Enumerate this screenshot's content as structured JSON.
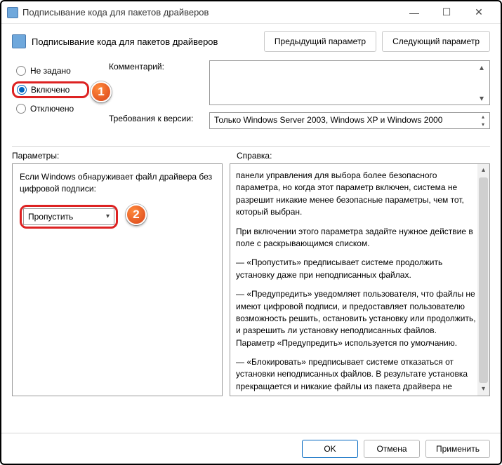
{
  "window": {
    "title": "Подписывание кода для пакетов драйверов",
    "min": "—",
    "max": "☐",
    "close": "✕"
  },
  "header": {
    "pageTitle": "Подписывание кода для пакетов драйверов",
    "prevBtn": "Предыдущий параметр",
    "nextBtn": "Следующий параметр"
  },
  "radios": {
    "notConfigured": "Не задано",
    "enabled": "Включено",
    "disabled": "Отключено"
  },
  "labels": {
    "comment": "Комментарий:",
    "requirements": "Требования к версии:",
    "parameters": "Параметры:",
    "help": "Справка:"
  },
  "requirementsText": "Только Windows Server 2003, Windows XP и Windows 2000",
  "options": {
    "prompt": "Если Windows обнаруживает файл драйвера без цифровой подписи:",
    "selected": "Пропустить"
  },
  "help": {
    "p1": "панели управления для выбора более безопасного параметра, но когда этот параметр включен, система не разрешит никакие менее безопасные параметры, чем тот, который выбран.",
    "p2": "При включении этого параметра задайте нужное действие в поле с раскрывающимся списком.",
    "p3": "—   «Пропустить» предписывает системе продолжить установку даже при неподписанных файлах.",
    "p4": "—   «Предупредить» уведомляет пользователя, что файлы не имеют цифровой подписи, и предоставляет пользователю возможность решить, остановить установку или продолжить, и разрешить ли установку неподписанных файлов. Параметр «Предупредить» используется по умолчанию.",
    "p5": "—   «Блокировать» предписывает системе отказаться от установки неподписанных файлов. В результате установка прекращается и никакие файлы из пакета драйвера не"
  },
  "badges": {
    "one": "1",
    "two": "2"
  },
  "footer": {
    "ok": "OK",
    "cancel": "Отмена",
    "apply": "Применить"
  }
}
